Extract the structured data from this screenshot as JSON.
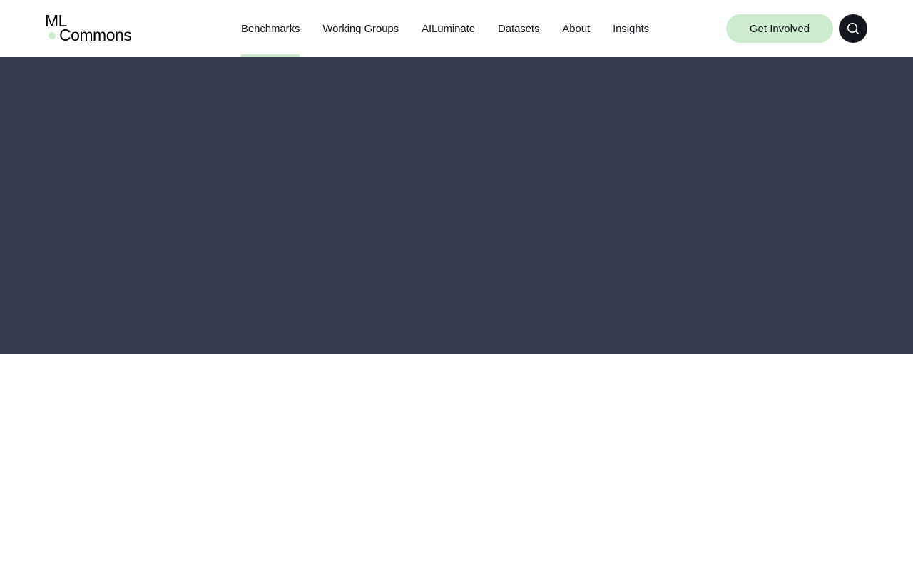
{
  "header": {
    "logo": {
      "line1": "ML",
      "line2": "Commons",
      "dot_color": "#cdeccf"
    },
    "nav": [
      {
        "label": "Benchmarks",
        "active": true
      },
      {
        "label": "Working Groups",
        "active": false
      },
      {
        "label": "AILuminate",
        "active": false
      },
      {
        "label": "Datasets",
        "active": false
      },
      {
        "label": "About",
        "active": false
      },
      {
        "label": "Insights",
        "active": false
      }
    ],
    "cta_label": "Get Involved",
    "search_icon": "search-icon"
  },
  "colors": {
    "accent": "#cdeccf",
    "dark": "#14161d",
    "hero_bg": "#353c50",
    "page_bg": "#ffffff"
  }
}
